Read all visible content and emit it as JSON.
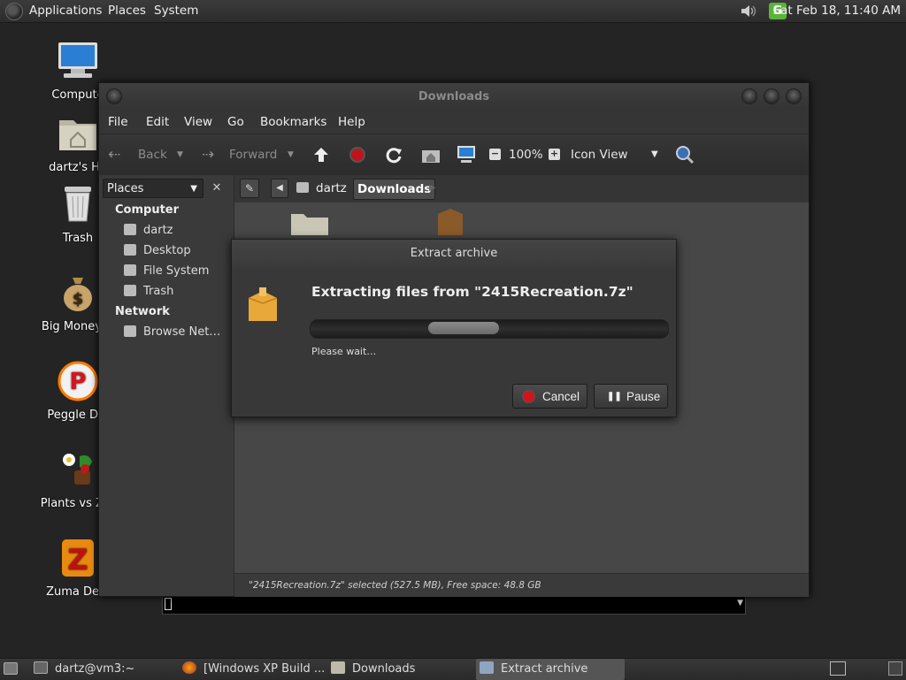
{
  "top_panel": {
    "menus": [
      "Applications",
      "Places",
      "System"
    ],
    "clock": "Sat Feb 18, 11:40 AM",
    "update_icon_letter": "G"
  },
  "desktop_icons": [
    {
      "label": "Compute",
      "icon": "computer-icon"
    },
    {
      "label": "dartz's Ho",
      "icon": "home-folder-icon"
    },
    {
      "label": "Trash",
      "icon": "trash-icon"
    },
    {
      "label": "Big Money D",
      "icon": "money-bag-icon"
    },
    {
      "label": "Peggle Del",
      "icon": "peggle-icon"
    },
    {
      "label": "Plants vs Zor",
      "icon": "plants-vs-zombies-icon"
    },
    {
      "label": "Zuma Delu",
      "icon": "zuma-icon"
    }
  ],
  "window": {
    "title": "Downloads",
    "menu": [
      "File",
      "Edit",
      "View",
      "Go",
      "Bookmarks",
      "Help"
    ],
    "toolbar": {
      "back": "Back",
      "forward": "Forward",
      "zoom": "100%",
      "view_mode": "Icon View"
    },
    "sidebar": {
      "selector": "Places",
      "sections": [
        {
          "heading": "Computer",
          "items": [
            "dartz",
            "Desktop",
            "File System",
            "Trash"
          ]
        },
        {
          "heading": "Network",
          "items": [
            "Browse Net…"
          ]
        }
      ]
    },
    "path": [
      "dartz",
      "Downloads"
    ],
    "status": "\"2415Recreation.7z\" selected (527.5 MB), Free space: 48.8 GB"
  },
  "dialog": {
    "title": "Extract archive",
    "heading": "Extracting files from \"2415Recreation.7z\"",
    "message": "Please wait…",
    "cancel_label": "Cancel",
    "pause_label": "Pause",
    "progress_activity_position": 0.41
  },
  "taskbar": [
    {
      "label": "dartz@vm3:~",
      "icon": "terminal-icon"
    },
    {
      "label": "[Windows XP Build ...",
      "icon": "firefox-icon"
    },
    {
      "label": "Downloads",
      "icon": "folder-icon"
    },
    {
      "label": "Extract archive",
      "icon": "archive-icon"
    }
  ],
  "colors": {
    "accent_highlight": "#5a5a5a",
    "cancel_red": "#d0141e",
    "update_green": "#5ab33a"
  }
}
